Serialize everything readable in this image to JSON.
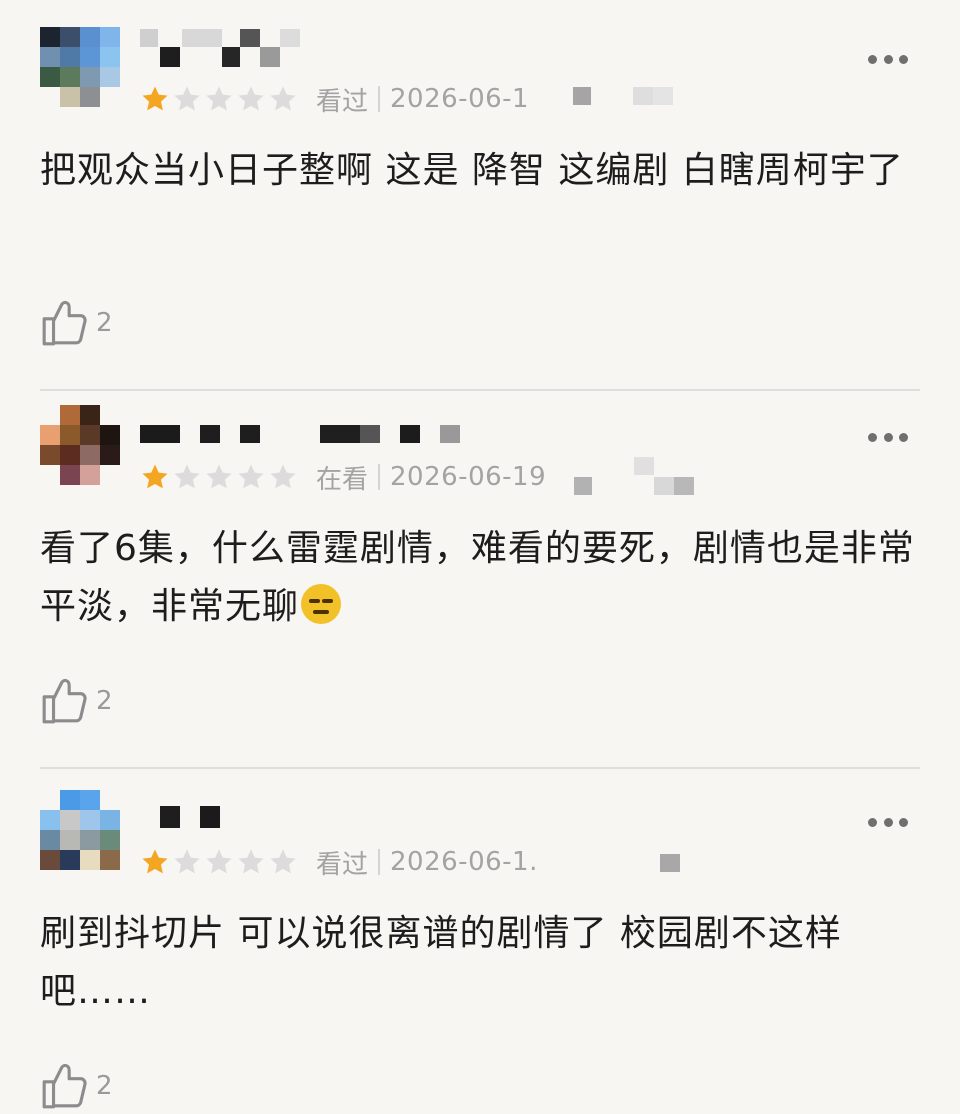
{
  "reviews": [
    {
      "status": "看过",
      "date": "2026-06-1",
      "rating": 1,
      "content": "把观众当小日子整啊 这是  降智 这编剧  白瞎周柯宇了",
      "likes": "2",
      "emoji": ""
    },
    {
      "status": "在看",
      "date": "2026-06-19",
      "rating": 1,
      "content": "看了6集，什么雷霆剧情，难看的要死，剧情也是非常平淡，非常无聊",
      "likes": "2",
      "emoji": "expressionless-face"
    },
    {
      "status": "看过",
      "date": "2026-06-1.",
      "rating": 1,
      "content": "刷到抖切片 可以说很离谱的剧情了 校园剧不这样吧……",
      "likes": "2",
      "emoji": ""
    }
  ],
  "icons": {
    "more": "more-horizontal-icon",
    "like": "thumbs-up-icon",
    "star": "star-icon"
  },
  "colors": {
    "star_filled": "#f4a623",
    "star_empty": "#dcdcdc",
    "meta_text": "#a3a3a3",
    "background": "#f7f6f3"
  }
}
